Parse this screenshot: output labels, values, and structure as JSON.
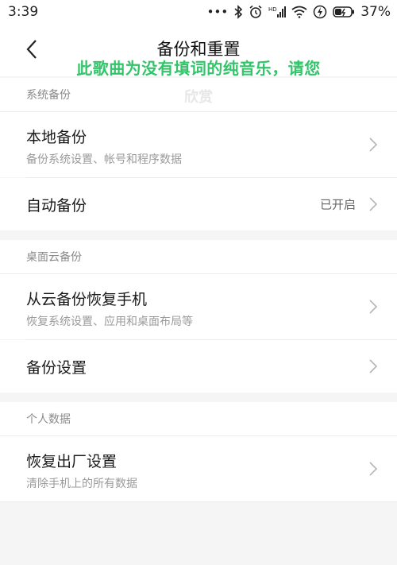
{
  "status": {
    "time": "3:39",
    "dots": "•••",
    "battery_percent": "37%",
    "hd_label": "HD"
  },
  "header": {
    "title": "备份和重置"
  },
  "overlay": {
    "lyric_line1": "此歌曲为没有填词的纯音乐，请您",
    "lyric_line2": "欣赏"
  },
  "sections": {
    "system": {
      "header": "系统备份",
      "local_backup": {
        "title": "本地备份",
        "subtitle": "备份系统设置、帐号和程序数据"
      },
      "auto_backup": {
        "title": "自动备份",
        "value": "已开启"
      }
    },
    "cloud": {
      "header": "桌面云备份",
      "restore": {
        "title": "从云备份恢复手机",
        "subtitle": "恢复系统设置、应用和桌面布局等"
      },
      "settings": {
        "title": "备份设置"
      }
    },
    "personal": {
      "header": "个人数据",
      "factory_reset": {
        "title": "恢复出厂设置",
        "subtitle": "清除手机上的所有数据"
      }
    }
  },
  "colors": {
    "lyric_green": "#33c46a",
    "background": "#f5f5f5",
    "item_bg": "#ffffff"
  }
}
